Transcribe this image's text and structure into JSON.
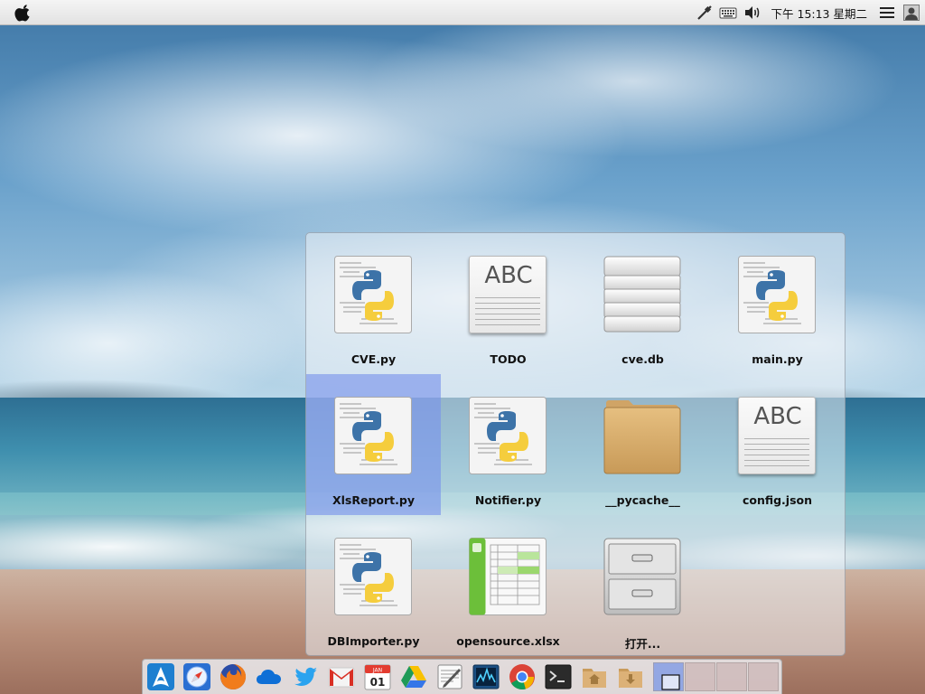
{
  "top_panel": {
    "clock": "下午 15:13 星期二"
  },
  "stack": {
    "items": [
      {
        "label": "CVE.py",
        "type": "python"
      },
      {
        "label": "TODO",
        "type": "text"
      },
      {
        "label": "cve.db",
        "type": "database"
      },
      {
        "label": "main.py",
        "type": "python"
      },
      {
        "label": "XlsReport.py",
        "type": "python",
        "selected": true
      },
      {
        "label": "Notifier.py",
        "type": "python"
      },
      {
        "label": "__pycache__",
        "type": "folder"
      },
      {
        "label": "config.json",
        "type": "text"
      },
      {
        "label": "DBImporter.py",
        "type": "python"
      },
      {
        "label": "opensource.xlsx",
        "type": "spreadsheet"
      },
      {
        "label": "打开...",
        "type": "filecabinet"
      }
    ],
    "abc_text": "ABC"
  },
  "dock": {
    "apps": [
      "arch-icon",
      "safari-icon",
      "firefox-icon",
      "onedrive-icon",
      "twitter-icon",
      "gmail-icon",
      "calendar-icon",
      "google-drive-icon",
      "text-editor-icon",
      "system-monitor-icon",
      "chrome-icon",
      "terminal-icon",
      "home-folder-icon",
      "downloads-folder-icon"
    ],
    "calendar_month": "JAN",
    "calendar_day": "01",
    "workspaces": 4
  }
}
